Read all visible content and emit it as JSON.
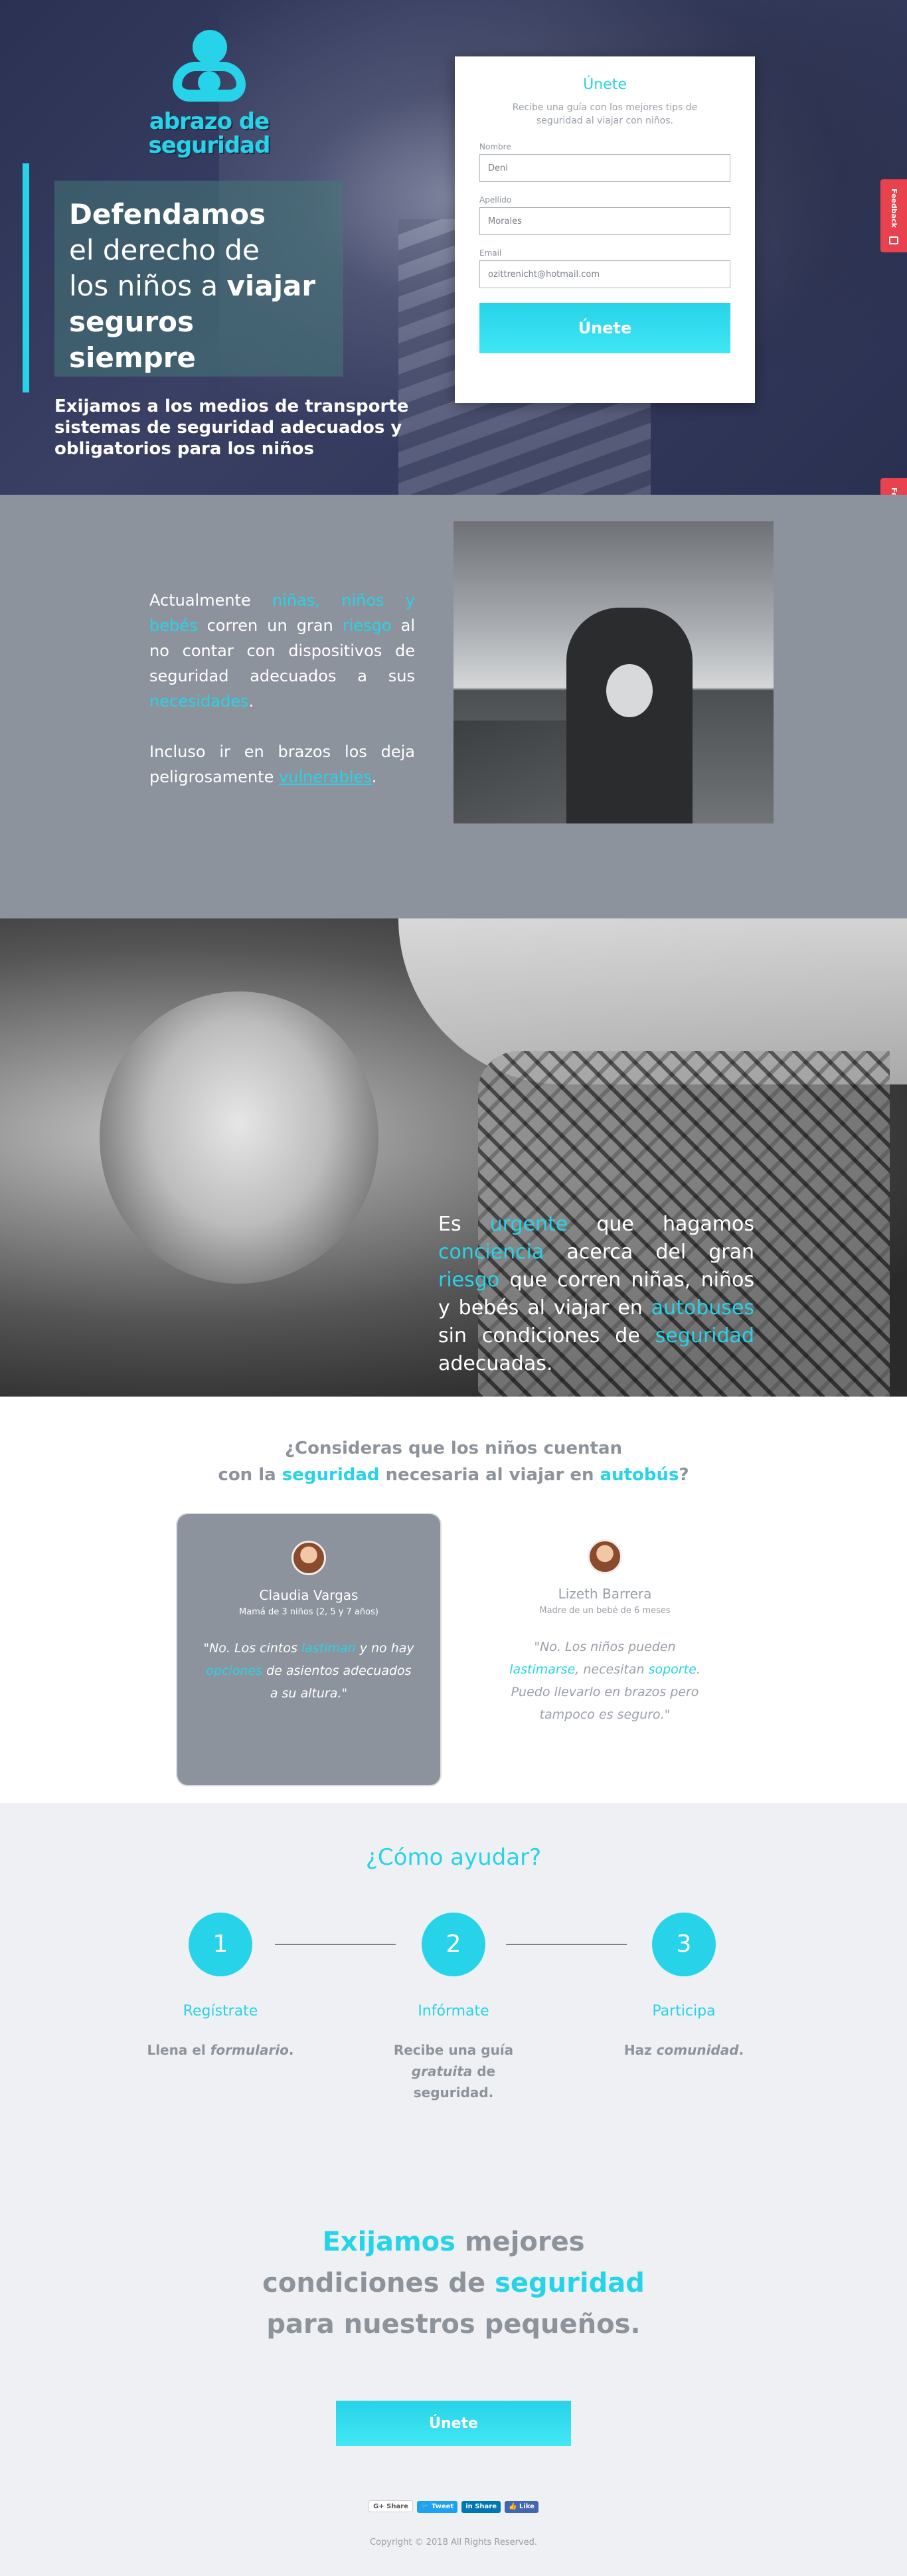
{
  "brand": {
    "line1": "abrazo de",
    "line2": "seguridad",
    "accent": "#27d3e8"
  },
  "hero": {
    "title_1": "Defendamos",
    "title_2": "el derecho de",
    "title_3a": "los niños a ",
    "title_3b": "viajar",
    "title_4": "seguros siempre",
    "subtitle": "Exijamos a los medios de transporte sistemas de seguridad adecuados y obligatorios para los niños"
  },
  "form": {
    "title": "Únete",
    "description": "Recibe una guía con los mejores tips de seguridad al viajar con niños.",
    "name_label": "Nombre",
    "name_value": "Deni",
    "lastname_label": "Apellido",
    "lastname_value": "Morales",
    "email_label": "Email",
    "email_value": "ozittrenicht@hotmail.com",
    "submit_label": "Únete"
  },
  "feedback_label": "Feedback",
  "section2": {
    "p1_a": "Actualmente ",
    "p1_b": "niñas, niños y bebés",
    "p1_c": " corren un gran ",
    "p1_d": "riesgo",
    "p1_e": " al no contar con dispositivos de seguridad adecuados a sus ",
    "p1_f": "necesidades",
    "p1_g": ".",
    "p2_a": "Incluso ir en brazos los deja peligrosamente ",
    "p2_b": "vulnerables",
    "p2_c": "."
  },
  "section3": {
    "a": "Es ",
    "b": "urgente",
    "c": " que hagamos ",
    "d": "conciencia",
    "e": " acerca del gran ",
    "f": "riesgo",
    "g": " que corren niñas, niños y bebés al viajar en ",
    "h": "autobuses",
    "i": " sin condiciones de ",
    "j": "seguridad",
    "k": " adecuadas."
  },
  "section4": {
    "q1": "¿Consideras que los niños cuentan",
    "q2a": "con la ",
    "q2b": "seguridad",
    "q2c": " necesaria al viajar en ",
    "q2d": "autobús",
    "q2e": "?",
    "testimonials": [
      {
        "name": "Claudia Vargas",
        "role": "Mamá de 3 niños (2, 5 y 7 años)",
        "q_a": "\"No. Los cintos ",
        "q_b": "lastiman",
        "q_c": " y no hay ",
        "q_d": "opciones",
        "q_e": " de asientos adecuados a su altura.\""
      },
      {
        "name": "Lizeth Barrera",
        "role": "Madre de un bebé de 6 meses",
        "q_a": "\"No. Los niños pueden ",
        "q_b": "lastimarse",
        "q_c": ", necesitan ",
        "q_d": "soporte",
        "q_e": ". Puedo llevarlo en brazos pero tampoco es seguro.\""
      }
    ]
  },
  "section5": {
    "title": "¿Cómo ayudar?",
    "steps": [
      {
        "num": "1",
        "title": "Regístrate",
        "desc_a": "Llena el ",
        "desc_b": "formulario",
        "desc_c": "."
      },
      {
        "num": "2",
        "title": "Infórmate",
        "desc_a": "Recibe una guía ",
        "desc_b": "gratuita",
        "desc_c": " de seguridad."
      },
      {
        "num": "3",
        "title": "Participa",
        "desc_a": "Haz ",
        "desc_b": "comunidad",
        "desc_c": "."
      }
    ],
    "cta_a": "Exijamos",
    "cta_b": " mejores",
    "cta_c": "condiciones de ",
    "cta_d": "seguridad",
    "cta_e": "para nuestros pequeños.",
    "button": "Únete"
  },
  "social": {
    "google": "Share",
    "twitter": "Tweet",
    "linkedin": "Share",
    "facebook": "Like"
  },
  "copyright": "Copyright © 2018 All Rights Reserved."
}
